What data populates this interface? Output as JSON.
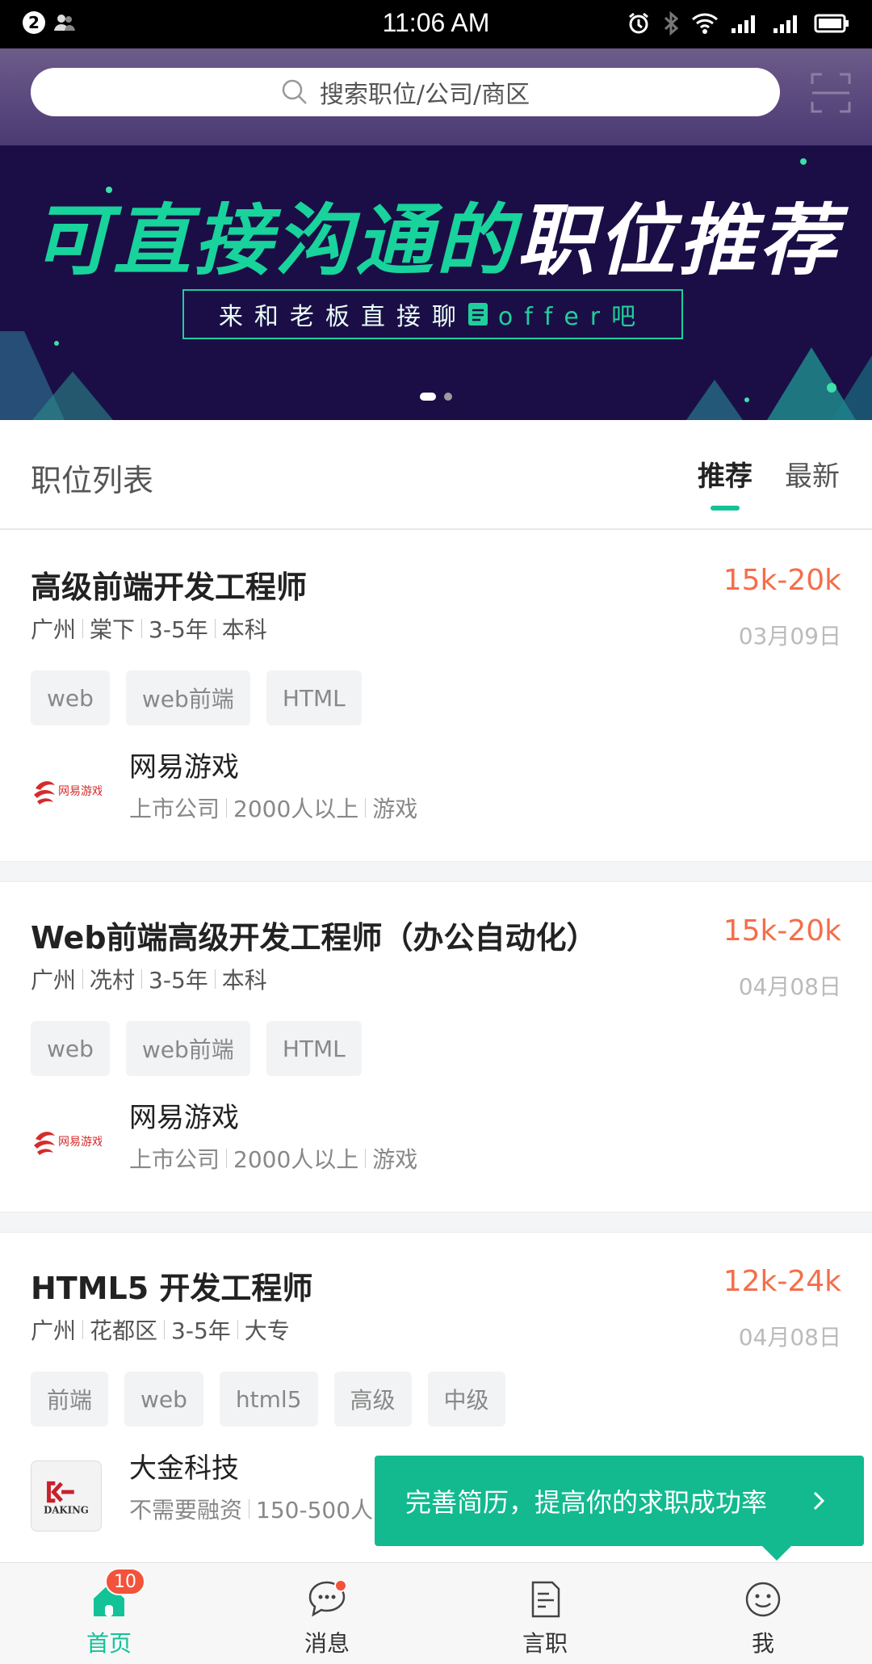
{
  "statusbar": {
    "notification_count": "2",
    "time": "11:06 AM"
  },
  "search": {
    "placeholder": "搜索职位/公司/商区"
  },
  "banner": {
    "title_green": "可直接沟通的",
    "title_white": "职位推荐",
    "subtitle_before": "来和老板直接聊",
    "subtitle_after": "offer吧",
    "slides": 2,
    "active_slide": 1
  },
  "list": {
    "title": "职位列表",
    "tab_recommend": "推荐",
    "tab_latest": "最新"
  },
  "jobs": [
    {
      "title": "高级前端开发工程师",
      "salary": "15k-20k",
      "date": "03月09日",
      "meta": [
        "广州",
        "棠下",
        "3-5年",
        "本科"
      ],
      "tags": [
        "web",
        "web前端",
        "HTML"
      ],
      "company": {
        "name": "网易游戏",
        "meta": [
          "上市公司",
          "2000人以上",
          "游戏"
        ],
        "logo_text": "网易游戏"
      }
    },
    {
      "title": "Web前端高级开发工程师（办公自动化）",
      "salary": "15k-20k",
      "date": "04月08日",
      "meta": [
        "广州",
        "冼村",
        "3-5年",
        "本科"
      ],
      "tags": [
        "web",
        "web前端",
        "HTML"
      ],
      "company": {
        "name": "网易游戏",
        "meta": [
          "上市公司",
          "2000人以上",
          "游戏"
        ],
        "logo_text": "网易游戏"
      }
    },
    {
      "title": "HTML5 开发工程师",
      "salary": "12k-24k",
      "date": "04月08日",
      "meta": [
        "广州",
        "花都区",
        "3-5年",
        "大专"
      ],
      "tags": [
        "前端",
        "web",
        "html5",
        "高级",
        "中级"
      ],
      "company": {
        "name": "大金科技",
        "meta": [
          "不需要融资",
          "150-500人"
        ],
        "logo_text": "DAKING"
      }
    }
  ],
  "toast": {
    "text": "完善简历，提高你的求职成功率"
  },
  "tabbar": {
    "home": "首页",
    "home_badge": "10",
    "messages": "消息",
    "jobs": "言职",
    "me": "我"
  },
  "colors": {
    "accent": "#13c297",
    "salary": "#f46e4b",
    "banner_bg": "#1b0e46",
    "badge": "#f2533a"
  }
}
